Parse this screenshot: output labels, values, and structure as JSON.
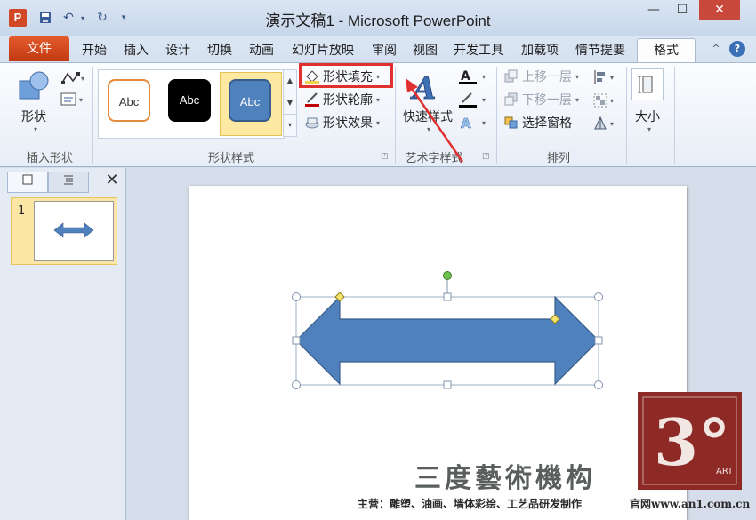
{
  "window": {
    "title": "演示文稿1 - Microsoft PowerPoint",
    "app_icon_letter": "P",
    "minimize_glyph": "—",
    "maximize_glyph": "☐",
    "close_glyph": "✕"
  },
  "tabs": [
    {
      "label": "文件",
      "kind": "file"
    },
    {
      "label": "开始"
    },
    {
      "label": "插入"
    },
    {
      "label": "设计"
    },
    {
      "label": "切换"
    },
    {
      "label": "动画"
    },
    {
      "label": "幻灯片放映"
    },
    {
      "label": "审阅"
    },
    {
      "label": "视图"
    },
    {
      "label": "开发工具"
    },
    {
      "label": "加载项"
    },
    {
      "label": "情节提要"
    },
    {
      "label": "格式",
      "active": true
    }
  ],
  "ribbon": {
    "insert_shapes": {
      "big_label": "形状",
      "group_label": "插入形状"
    },
    "shape_styles": {
      "group_label": "形状样式",
      "gallery": [
        {
          "text": "Abc",
          "style": "orange-outline"
        },
        {
          "text": "Abc",
          "style": "black-fill"
        },
        {
          "text": "Abc",
          "style": "blue-fill-selected"
        }
      ],
      "shape_fill": "形状填充",
      "shape_outline": "形状轮廓",
      "shape_effects": "形状效果"
    },
    "wordart_styles": {
      "big_label": "快速样式",
      "group_label": "艺术字样式",
      "icon_letter": "A"
    },
    "arrange": {
      "bring_forward": "上移一层",
      "send_backward": "下移一层",
      "selection_pane": "选择窗格",
      "group_label": "排列"
    },
    "size": {
      "big_label": "大小"
    }
  },
  "left_pane": {
    "slide_number": "1"
  },
  "colors": {
    "shape_fill": "#4f81bd",
    "highlight_box": "#e03030",
    "file_tab": "#d24b20",
    "watermark_logo": "#8e2a26"
  },
  "watermark": {
    "calligraphy": "三度藝術機构",
    "line": "主营：雕塑、油画、墙体彩绘、工艺品研发制作",
    "site": "官网www.an1.com.cn",
    "logo_text": "3°",
    "logo_sub": "ART"
  }
}
